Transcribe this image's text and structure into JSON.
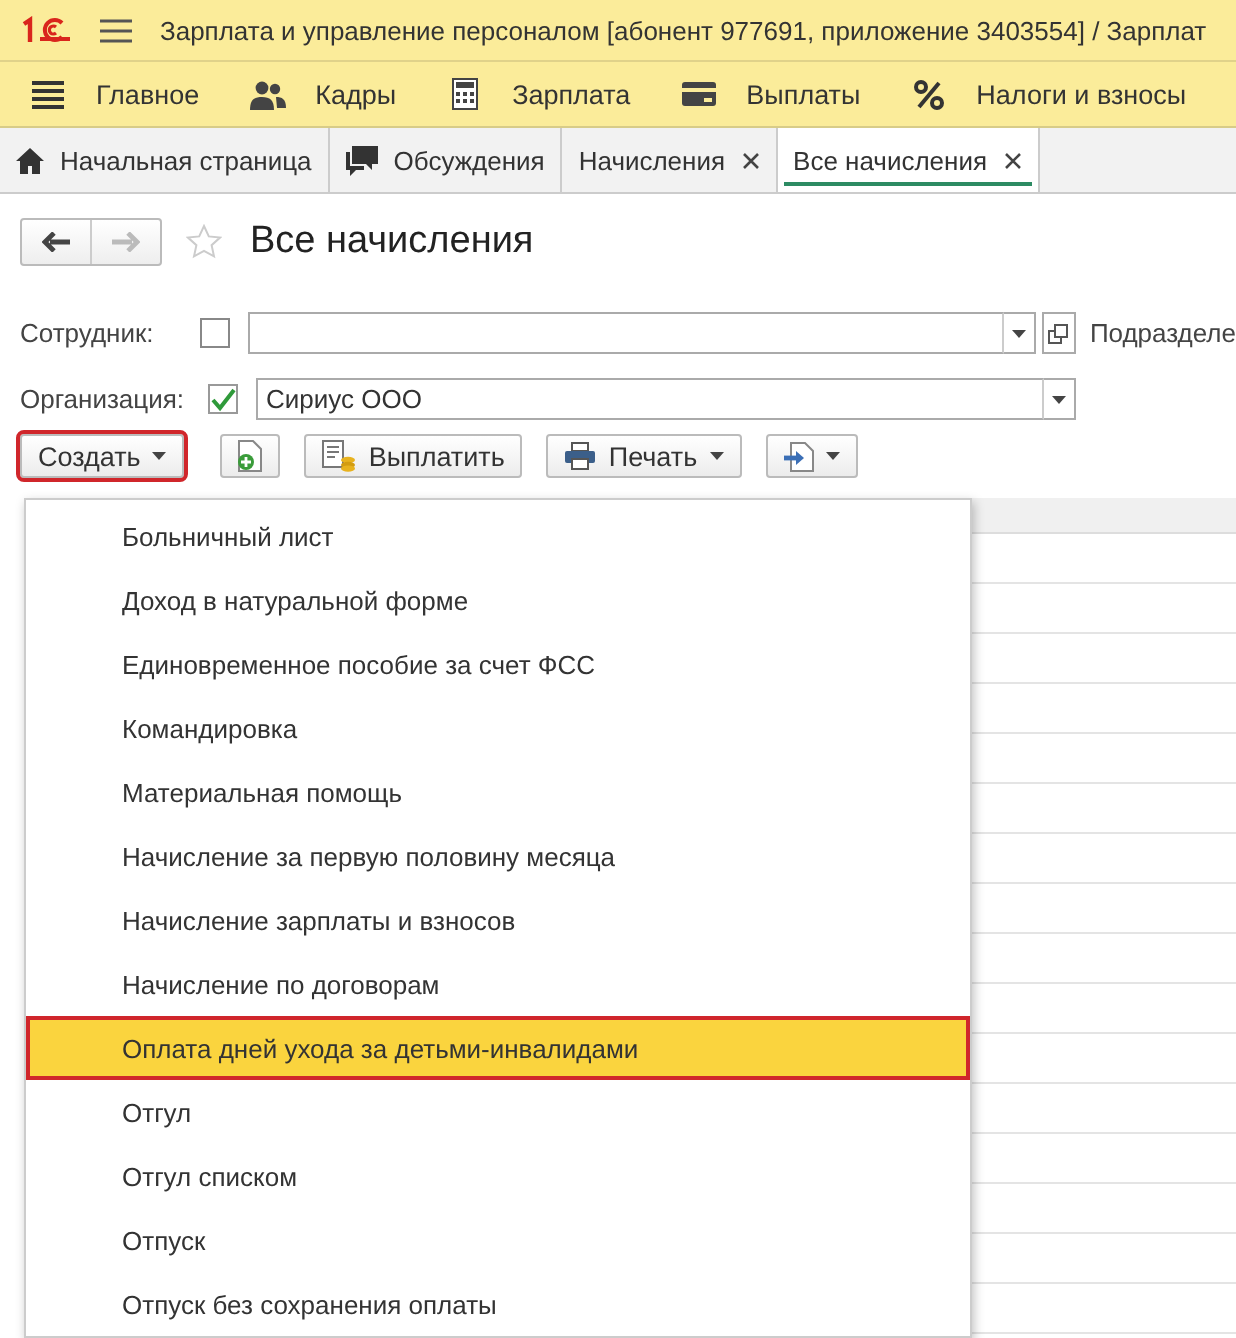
{
  "window": {
    "title": "Зарплата и управление персоналом [абонент 977691, приложение 3403554] / Зарплат"
  },
  "sections": [
    {
      "label": "Главное"
    },
    {
      "label": "Кадры"
    },
    {
      "label": "Зарплата"
    },
    {
      "label": "Выплаты"
    },
    {
      "label": "Налоги и взносы"
    }
  ],
  "tabs": [
    {
      "label": "Начальная страница",
      "closable": false,
      "selected": false
    },
    {
      "label": "Обсуждения",
      "closable": false,
      "selected": false
    },
    {
      "label": "Начисления",
      "closable": true,
      "selected": false
    },
    {
      "label": "Все начисления",
      "closable": true,
      "selected": true
    }
  ],
  "form": {
    "title": "Все начисления",
    "favorite": false
  },
  "filters": [
    {
      "label": "Сотрудник:",
      "checked": false,
      "has_open_button": true,
      "next_label": "Подразделе"
    },
    {
      "label": "Организация:",
      "checked": true,
      "value": "Сириус ООО",
      "has_open_button": false
    }
  ],
  "toolbar": [
    {
      "kind": "dropdown",
      "label": "Создать",
      "highlighted": true
    },
    {
      "kind": "icon",
      "highlighted": false
    },
    {
      "kind": "button",
      "label": "Выплатить",
      "highlighted": false
    },
    {
      "kind": "dropdown",
      "label": "Печать",
      "highlighted": false
    },
    {
      "kind": "icon-dropdown",
      "highlighted": false
    }
  ],
  "menu": [
    {
      "label": "Больничный лист",
      "selected": false
    },
    {
      "label": "Доход в натуральной форме",
      "selected": false
    },
    {
      "label": "Единовременное пособие за счет ФСС",
      "selected": false
    },
    {
      "label": "Командировка",
      "selected": false
    },
    {
      "label": "Материальная помощь",
      "selected": false
    },
    {
      "label": "Начисление за первую половину месяца",
      "selected": false
    },
    {
      "label": "Начисление зарплаты и взносов",
      "selected": false
    },
    {
      "label": "Начисление по договорам",
      "selected": false
    },
    {
      "label": "Оплата дней ухода за детьми-инвалидами",
      "selected": true
    },
    {
      "label": "Отгул",
      "selected": false
    },
    {
      "label": "Отгул списком",
      "selected": false
    },
    {
      "label": "Отпуск",
      "selected": false
    },
    {
      "label": "Отпуск без сохранения оплаты",
      "selected": false
    }
  ]
}
